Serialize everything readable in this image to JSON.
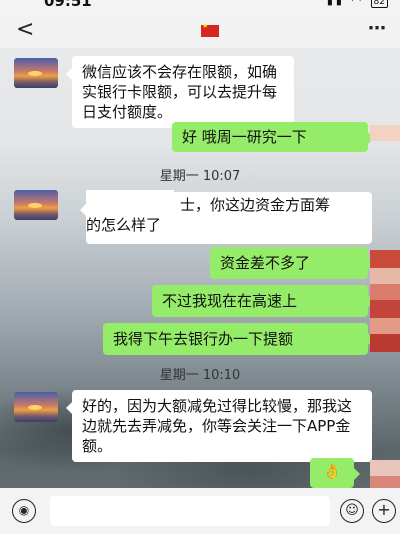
{
  "status_bar": {
    "time": "09:51",
    "battery": "82"
  },
  "nav": {
    "back": "<",
    "more": "⋯"
  },
  "messages": {
    "m1": "微信应该不会存在限额，如确实银行卡限额，可以去提升每日支付额度。",
    "m2": "好 哦周一研究一下",
    "ts1": "星期一 10:07",
    "m3a": "士，你这边资金方面筹",
    "m3b": "的怎么样了",
    "m4": "资金差不多了",
    "m5": "不过我现在在高速上",
    "m6": "我得下午去银行办一下提额",
    "ts2": "星期一 10:10",
    "m7": "好的，因为大额减免过得比较慢，那我这边就先去弄减免，你等会关注一下APP金额。"
  },
  "sticker": {
    "icon": "thumbs-up-icon",
    "glyph": "👌"
  },
  "input_bar": {
    "voice_glyph": "◉",
    "emoji_glyph": "☺",
    "plus_glyph": "+"
  },
  "colors": {
    "sent": "#95ec69",
    "received": "#ffffff"
  }
}
